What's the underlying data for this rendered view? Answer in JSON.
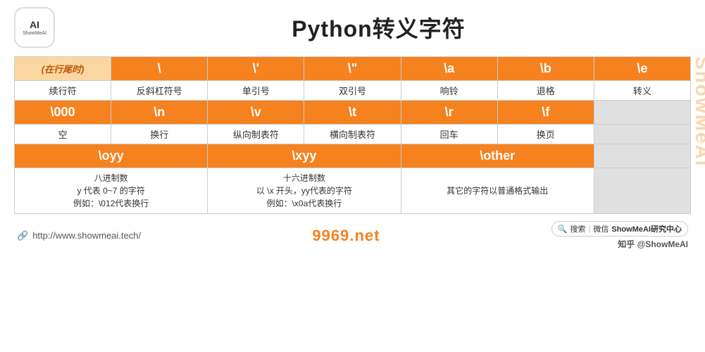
{
  "header": {
    "logo_ai": "AI",
    "logo_brand": "ShowMeAI",
    "title": "Python转义字符"
  },
  "watermark": "ShowMeAI",
  "table": {
    "row1": {
      "cells": [
        "(在行尾时)",
        "\\",
        "\\'",
        "\\\"",
        "\\a",
        "\\b",
        "\\e"
      ],
      "type": "orange-header"
    },
    "row2": {
      "cells": [
        "续行符",
        "反斜杠符号",
        "单引号",
        "双引号",
        "响铃",
        "退格",
        "转义"
      ],
      "type": "light"
    },
    "row3": {
      "cells": [
        "\\000",
        "\\n",
        "\\v",
        "\\t",
        "\\r",
        "\\f",
        ""
      ],
      "type": "orange-header"
    },
    "row4": {
      "cells": [
        "空",
        "换行",
        "纵向制表符",
        "横向制表符",
        "回车",
        "换页",
        ""
      ],
      "type": "light"
    },
    "row5_cols": [
      {
        "label": "\\oyy",
        "span": 2
      },
      {
        "label": "\\xyy",
        "span": 2
      },
      {
        "label": "\\other",
        "span": 2
      }
    ],
    "row6_cols": [
      {
        "text": "八进制数\ny 代表 0~7 的字符\n例如：\\012代表换行",
        "span": 2
      },
      {
        "text": "十六进制数\n以 \\x 开头，yy代表的字符\n例如：\\x0a代表换行",
        "span": 2
      },
      {
        "text": "其它的字符以普通格式输出",
        "span": 2
      }
    ]
  },
  "footer": {
    "url": "http://www.showmeai.tech/",
    "center_text": "9969.net",
    "search_text": "搜索",
    "search_sep": "|",
    "search_weixin": "微信",
    "search_brand": "ShowMeAI研究中心",
    "zhihu_prefix": "知乎 @",
    "zhihu_brand": "ShowMeAI"
  }
}
